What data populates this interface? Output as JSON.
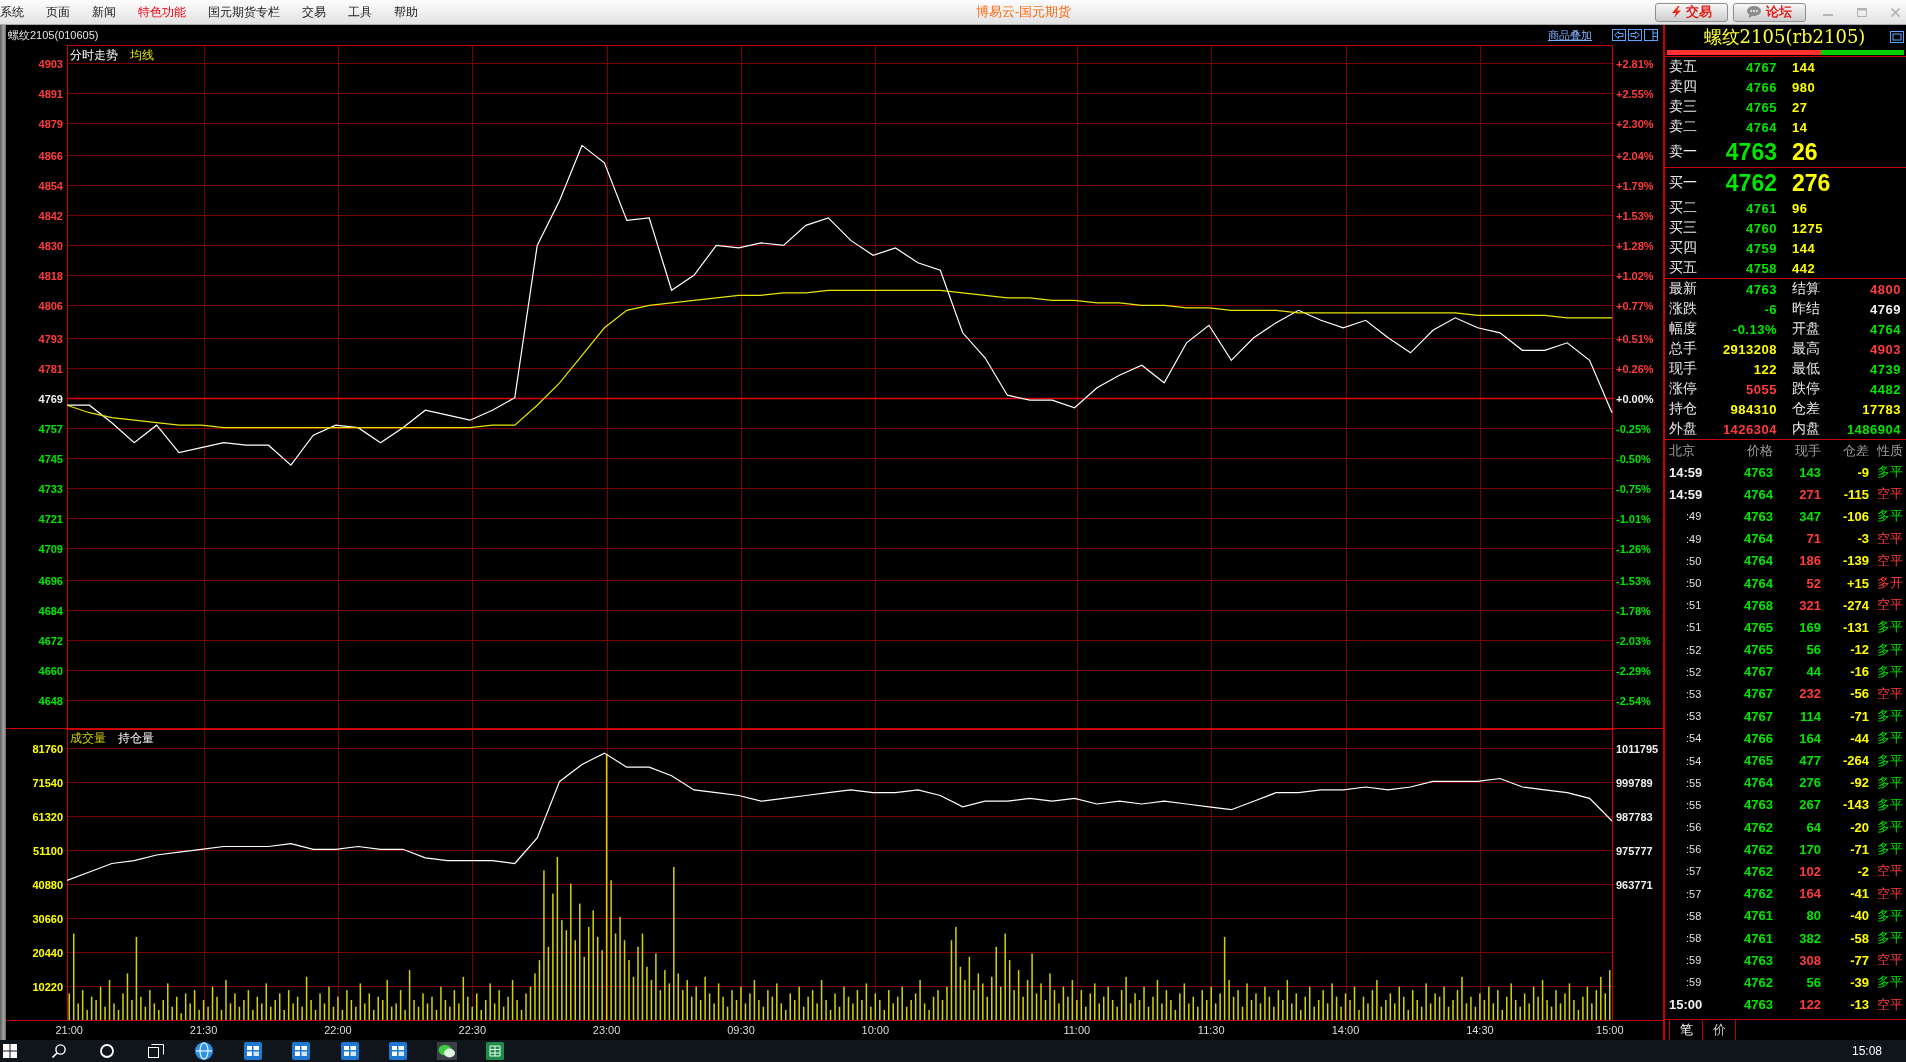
{
  "menu_bar": {
    "items": [
      {
        "label": "系统",
        "highlighted": false
      },
      {
        "label": "页面",
        "highlighted": false
      },
      {
        "label": "新闻",
        "highlighted": false
      },
      {
        "label": "特色功能",
        "highlighted": true
      },
      {
        "label": "国元期货专栏",
        "highlighted": false
      },
      {
        "label": "交易",
        "highlighted": false
      },
      {
        "label": "工具",
        "highlighted": false
      },
      {
        "label": "帮助",
        "highlighted": false
      }
    ],
    "title": "博易云-国元期货",
    "buttons": [
      {
        "kind": "trade",
        "label": "交易"
      },
      {
        "kind": "forum",
        "label": "论坛"
      }
    ]
  },
  "chart_header": {
    "symbol": "螺纹2105(010605)",
    "overlay_link": "商品叠加"
  },
  "price_panel": {
    "percent_axis": [
      "+2.81%",
      "+2.55%",
      "+2.30%",
      "+2.04%",
      "+1.79%",
      "+1.53%",
      "+1.28%",
      "+1.02%",
      "+0.77%",
      "+0.51%",
      "+0.26%",
      "+0.00%",
      "-0.25%",
      "-0.50%",
      "-0.75%",
      "-1.01%",
      "-1.26%",
      "-1.53%",
      "-1.78%",
      "-2.03%",
      "-2.29%",
      "-2.54%"
    ],
    "chart_data": {
      "type": "line",
      "ylim": [
        4636.8,
        4910.2
      ],
      "yticks": [
        4903,
        4891,
        4879,
        4866,
        4854,
        4842,
        4830,
        4818,
        4806,
        4793,
        4781,
        4769,
        4757,
        4745,
        4733,
        4721,
        4709,
        4696,
        4684,
        4672,
        4660,
        4648
      ],
      "grid": true,
      "series": [
        {
          "name": "分时走势",
          "color": "#ffffff",
          "values": [
            4766,
            4766,
            4759,
            4751,
            4758,
            4747,
            4749,
            4751,
            4750,
            4750,
            4742,
            4754,
            4758,
            4757,
            4751,
            4757,
            4764,
            4762,
            4760,
            4764,
            4769,
            4830,
            4848,
            4870,
            4863,
            4840,
            4841,
            4812,
            4818,
            4830,
            4829,
            4831,
            4830,
            4838,
            4841,
            4832,
            4826,
            4829,
            4823,
            4820,
            4795,
            4785,
            4770,
            4768,
            4768,
            4765,
            4773,
            4778,
            4782,
            4775,
            4791,
            4798,
            4784,
            4793,
            4799,
            4804,
            4800,
            4797,
            4800,
            4793,
            4787,
            4796,
            4801,
            4797,
            4795,
            4788,
            4788,
            4791,
            4784,
            4763
          ]
        },
        {
          "name": "均线",
          "color": "#e6e600",
          "values": [
            4766,
            4763,
            4761,
            4760,
            4759,
            4758,
            4758,
            4757,
            4757,
            4757,
            4757,
            4757,
            4757,
            4757,
            4757,
            4757,
            4757,
            4757,
            4757,
            4758,
            4758,
            4766,
            4775,
            4786,
            4797,
            4804,
            4806,
            4807,
            4808,
            4809,
            4810,
            4810,
            4811,
            4811,
            4812,
            4812,
            4812,
            4812,
            4812,
            4812,
            4811,
            4810,
            4809,
            4809,
            4808,
            4808,
            4807,
            4807,
            4806,
            4806,
            4805,
            4805,
            4804,
            4804,
            4804,
            4803,
            4803,
            4803,
            4803,
            4803,
            4803,
            4803,
            4803,
            4802,
            4802,
            4802,
            4802,
            4801,
            4801,
            4801
          ]
        }
      ],
      "ref_lines": [
        {
          "axis": "y",
          "value": 4769
        }
      ]
    }
  },
  "volume_panel": {
    "volume_chart": {
      "chart_data": {
        "type": "bar",
        "categories": [
          "21:00",
          null,
          null,
          null,
          null,
          null,
          null,
          null,
          null,
          null,
          null,
          null,
          null,
          null,
          null,
          null,
          null,
          null,
          null,
          null,
          null,
          null,
          null,
          null,
          null,
          null,
          null,
          null,
          null,
          null,
          "21:30",
          null,
          null,
          null,
          null,
          null,
          null,
          null,
          null,
          null,
          null,
          null,
          null,
          null,
          null,
          null,
          null,
          null,
          null,
          null,
          null,
          null,
          null,
          null,
          null,
          null,
          null,
          null,
          null,
          null,
          "22:00",
          null,
          null,
          null,
          null,
          null,
          null,
          null,
          null,
          null,
          null,
          null,
          null,
          null,
          null,
          null,
          null,
          null,
          null,
          null,
          null,
          null,
          null,
          null,
          null,
          null,
          null,
          null,
          null,
          null,
          "22:30",
          null,
          null,
          null,
          null,
          null,
          null,
          null,
          null,
          null,
          null,
          null,
          null,
          null,
          null,
          null,
          null,
          null,
          null,
          null,
          null,
          null,
          null,
          null,
          null,
          null,
          null,
          null,
          null,
          null,
          "23:00",
          null,
          null,
          null,
          null,
          null,
          null,
          null,
          null,
          null,
          null,
          null,
          null,
          null,
          null,
          null,
          null,
          null,
          null,
          null,
          null,
          null,
          null,
          null,
          null,
          null,
          null,
          null,
          null,
          null,
          "09:30",
          null,
          null,
          null,
          null,
          null,
          null,
          null,
          null,
          null,
          null,
          null,
          null,
          null,
          null,
          null,
          null,
          null,
          null,
          null,
          null,
          null,
          null,
          null,
          null,
          null,
          null,
          null,
          null,
          null,
          "10:00",
          null,
          null,
          null,
          null,
          null,
          null,
          null,
          null,
          null,
          null,
          null,
          null,
          null,
          null,
          null,
          null,
          null,
          null,
          null,
          null,
          null,
          null,
          null,
          null,
          null,
          null,
          null,
          null,
          null,
          null,
          null,
          null,
          null,
          null,
          null,
          null,
          null,
          null,
          null,
          null,
          null,
          null,
          null,
          null,
          "11:00",
          null,
          null,
          null,
          null,
          null,
          null,
          null,
          null,
          null,
          null,
          null,
          null,
          null,
          null,
          null,
          null,
          null,
          null,
          null,
          null,
          null,
          null,
          null,
          null,
          null,
          null,
          null,
          null,
          null,
          "11:30",
          null,
          null,
          null,
          null,
          null,
          null,
          null,
          null,
          null,
          null,
          null,
          null,
          null,
          null,
          null,
          null,
          null,
          null,
          null,
          null,
          null,
          null,
          null,
          null,
          null,
          null,
          null,
          null,
          null,
          "14:00",
          null,
          null,
          null,
          null,
          null,
          null,
          null,
          null,
          null,
          null,
          null,
          null,
          null,
          null,
          null,
          null,
          null,
          null,
          null,
          null,
          null,
          null,
          null,
          null,
          null,
          null,
          null,
          null,
          null,
          "14:30",
          null,
          null,
          null,
          null,
          null,
          null,
          null,
          null,
          null,
          null,
          null,
          null,
          null,
          null,
          null,
          null,
          null,
          null,
          null,
          null,
          null,
          null,
          null,
          null,
          null,
          null,
          null,
          null,
          "15:00"
        ],
        "ylim": [
          0,
          87500
        ],
        "yticks": [
          81760,
          71540,
          61320,
          51100,
          40880,
          30660,
          20440,
          10220
        ],
        "grid": true,
        "series": [
          {
            "name": "成交量",
            "color": "#d2d200",
            "values": [
              8000,
              26000,
              5000,
              9000,
              3000,
              7000,
              6000,
              10000,
              4000,
              12000,
              5000,
              3000,
              8000,
              14000,
              6000,
              25000,
              7000,
              4000,
              9000,
              5000,
              3000,
              6000,
              11000,
              4000,
              7000,
              2000,
              8000,
              5000,
              9000,
              3000,
              6000,
              4000,
              10000,
              7000,
              3000,
              12000,
              5000,
              8000,
              4000,
              6000,
              9000,
              3000,
              7000,
              5000,
              11000,
              4000,
              6000,
              8000,
              3000,
              9000,
              5000,
              7000,
              4000,
              13000,
              6000,
              3000,
              8000,
              5000,
              10000,
              4000,
              7000,
              3000,
              9000,
              6000,
              4000,
              11000,
              5000,
              8000,
              3000,
              7000,
              6000,
              12000,
              4000,
              5000,
              9000,
              3000,
              15000,
              6000,
              4000,
              8000,
              5000,
              7000,
              3000,
              10000,
              6000,
              4000,
              9000,
              5000,
              13000,
              7000,
              4000,
              8000,
              3000,
              6000,
              11000,
              5000,
              9000,
              4000,
              7000,
              12000,
              6000,
              3000,
              8000,
              10000,
              14000,
              18000,
              45000,
              22000,
              38000,
              49000,
              30000,
              27000,
              41000,
              24000,
              35000,
              19000,
              28000,
              33000,
              25000,
              21000,
              80000,
              42000,
              26000,
              31000,
              24000,
              18000,
              13000,
              22000,
              26000,
              16000,
              12000,
              20000,
              9000,
              15000,
              11000,
              46000,
              14000,
              9000,
              12000,
              7000,
              10000,
              6000,
              13000,
              8000,
              5000,
              11000,
              7000,
              4000,
              9000,
              6000,
              10000,
              5000,
              8000,
              12000,
              6000,
              4000,
              9000,
              7000,
              11000,
              5000,
              3000,
              8000,
              6000,
              10000,
              4000,
              7000,
              9000,
              5000,
              12000,
              6000,
              3000,
              8000,
              4000,
              10000,
              7000,
              5000,
              9000,
              6000,
              11000,
              4000,
              8000,
              6000,
              3000,
              9000,
              5000,
              7000,
              10000,
              4000,
              6000,
              8000,
              12000,
              5000,
              3000,
              7000,
              9000,
              6000,
              10000,
              24000,
              28000,
              16000,
              12000,
              19000,
              9000,
              14000,
              11000,
              7000,
              13000,
              22000,
              10000,
              26000,
              18000,
              9000,
              15000,
              7000,
              12000,
              20000,
              8000,
              11000,
              6000,
              14000,
              9000,
              5000,
              10000,
              7000,
              12000,
              6000,
              9000,
              4000,
              8000,
              11000,
              5000,
              7000,
              10000,
              6000,
              4000,
              9000,
              13000,
              5000,
              8000,
              6000,
              10000,
              4000,
              7000,
              12000,
              5000,
              9000,
              6000,
              3000,
              8000,
              11000,
              5000,
              7000,
              4000,
              9000,
              6000,
              10000,
              5000,
              8000,
              25000,
              12000,
              7000,
              9000,
              4000,
              11000,
              6000,
              8000,
              5000,
              10000,
              7000,
              4000,
              9000,
              6000,
              12000,
              5000,
              8000,
              3000,
              7000,
              10000,
              4000,
              6000,
              9000,
              5000,
              11000,
              7000,
              4000,
              8000,
              6000,
              10000,
              3000,
              7000,
              5000,
              9000,
              12000,
              4000,
              6000,
              8000,
              5000,
              10000,
              7000,
              3000,
              9000,
              6000,
              4000,
              11000,
              5000,
              8000,
              7000,
              10000,
              4000,
              6000,
              9000,
              13000,
              5000,
              7000,
              4000,
              8000,
              6000,
              10000,
              5000,
              9000,
              3000,
              7000,
              11000,
              6000,
              4000,
              8000,
              5000,
              10000,
              7000,
              12000,
              6000,
              4000,
              9000,
              5000,
              8000,
              11000,
              6000,
              3000,
              7000,
              10000,
              5000,
              9000,
              13000,
              8000,
              15000
            ]
          }
        ]
      }
    },
    "open_interest_chart": {
      "chart_data": {
        "type": "line",
        "ylim": [
          915700,
          1018500
        ],
        "yticks": [
          1011795,
          999789,
          987783,
          975777,
          963771
        ],
        "series": [
          {
            "name": "持仓量",
            "color": "#ffffff",
            "values": [
              965000,
              968000,
              971000,
              972000,
              974000,
              975000,
              976000,
              977000,
              977000,
              977000,
              978000,
              976000,
              976000,
              977000,
              976000,
              976000,
              973000,
              972000,
              972000,
              972000,
              971000,
              980000,
              1000000,
              1006000,
              1010000,
              1005000,
              1005000,
              1002000,
              997000,
              996000,
              995000,
              993000,
              994000,
              995000,
              996000,
              997000,
              996000,
              996000,
              997000,
              995000,
              991000,
              993000,
              993000,
              994000,
              993000,
              994000,
              992000,
              993000,
              992000,
              993000,
              992000,
              991000,
              990000,
              993000,
              996000,
              996000,
              997000,
              997000,
              998000,
              997000,
              998000,
              1000000,
              1000000,
              1000000,
              1001000,
              998000,
              997000,
              996000,
              994000,
              986000
            ]
          }
        ]
      }
    }
  },
  "quote_panel": {
    "title": "螺纹2105(rb2105)",
    "ratio_bar": {
      "level": 0.65
    },
    "asks": [
      {
        "kind": "normal",
        "label": "卖五",
        "price": "4767",
        "volume": "144"
      },
      {
        "kind": "normal",
        "label": "卖四",
        "price": "4766",
        "volume": "980"
      },
      {
        "kind": "normal",
        "label": "卖三",
        "price": "4765",
        "volume": "27"
      },
      {
        "kind": "normal",
        "label": "卖二",
        "price": "4764",
        "volume": "14"
      },
      {
        "kind": "best",
        "label": "卖一",
        "price": "4763",
        "volume": "26"
      }
    ],
    "bids": [
      {
        "kind": "best",
        "label": "买一",
        "price": "4762",
        "volume": "276"
      },
      {
        "kind": "normal",
        "label": "买二",
        "price": "4761",
        "volume": "96"
      },
      {
        "kind": "normal",
        "label": "买三",
        "price": "4760",
        "volume": "1275"
      },
      {
        "kind": "normal",
        "label": "买四",
        "price": "4759",
        "volume": "144"
      },
      {
        "kind": "normal",
        "label": "买五",
        "price": "4758",
        "volume": "442"
      }
    ],
    "stats": [
      {
        "label": "最新",
        "value": "4763",
        "color": "#00e600"
      },
      {
        "label": "结算",
        "value": "4800",
        "color": "#ff3c3c"
      },
      {
        "label": "涨跌",
        "value": "-6",
        "color": "#00e600"
      },
      {
        "label": "昨结",
        "value": "4769",
        "color": "#f0f0f0"
      },
      {
        "label": "幅度",
        "value": "-0.13%",
        "color": "#00e600"
      },
      {
        "label": "开盘",
        "value": "4764",
        "color": "#00e600"
      },
      {
        "label": "总手",
        "value": "2913208",
        "color": "#ffff00"
      },
      {
        "label": "最高",
        "value": "4903",
        "color": "#ff3c3c"
      },
      {
        "label": "现手",
        "value": "122",
        "color": "#ffff00"
      },
      {
        "label": "最低",
        "value": "4739",
        "color": "#00e600"
      },
      {
        "label": "涨停",
        "value": "5055",
        "color": "#ff3c3c"
      },
      {
        "label": "跌停",
        "value": "4482",
        "color": "#00e600"
      },
      {
        "label": "持仓",
        "value": "984310",
        "color": "#ffff00"
      },
      {
        "label": "仓差",
        "value": "17783",
        "color": "#ffff00"
      },
      {
        "label": "外盘",
        "value": "1426304",
        "color": "#ff3c3c"
      },
      {
        "label": "内盘",
        "value": "1486904",
        "color": "#00e600"
      }
    ],
    "trades": {
      "columns": [
        "北京",
        "价格",
        "现手",
        "仓差",
        "性质"
      ],
      "rows": [
        {
          "time": "14:59",
          "kind": "full",
          "price": "4763",
          "volume": "143",
          "change": "-9",
          "nature": "多平",
          "buy": false
        },
        {
          "time": "14:59",
          "kind": "full",
          "price": "4764",
          "volume": "271",
          "change": "-115",
          "nature": "空平",
          "buy": true
        },
        {
          "time": ":49",
          "kind": "seconds",
          "price": "4763",
          "volume": "347",
          "change": "-106",
          "nature": "多平",
          "buy": false
        },
        {
          "time": ":49",
          "kind": "seconds",
          "price": "4764",
          "volume": "71",
          "change": "-3",
          "nature": "空平",
          "buy": true
        },
        {
          "time": ":50",
          "kind": "seconds",
          "price": "4764",
          "volume": "186",
          "change": "-139",
          "nature": "空平",
          "buy": true
        },
        {
          "time": ":50",
          "kind": "seconds",
          "price": "4764",
          "volume": "52",
          "change": "+15",
          "nature": "多开",
          "buy": true
        },
        {
          "time": ":51",
          "kind": "seconds",
          "price": "4768",
          "volume": "321",
          "change": "-274",
          "nature": "空平",
          "buy": true
        },
        {
          "time": ":51",
          "kind": "seconds",
          "price": "4765",
          "volume": "169",
          "change": "-131",
          "nature": "多平",
          "buy": false
        },
        {
          "time": ":52",
          "kind": "seconds",
          "price": "4765",
          "volume": "56",
          "change": "-12",
          "nature": "多平",
          "buy": false
        },
        {
          "time": ":52",
          "kind": "seconds",
          "price": "4767",
          "volume": "44",
          "change": "-16",
          "nature": "多平",
          "buy": false
        },
        {
          "time": ":53",
          "kind": "seconds",
          "price": "4767",
          "volume": "232",
          "change": "-56",
          "nature": "空平",
          "buy": true
        },
        {
          "time": ":53",
          "kind": "seconds",
          "price": "4767",
          "volume": "114",
          "change": "-71",
          "nature": "多平",
          "buy": false
        },
        {
          "time": ":54",
          "kind": "seconds",
          "price": "4766",
          "volume": "164",
          "change": "-44",
          "nature": "多平",
          "buy": false
        },
        {
          "time": ":54",
          "kind": "seconds",
          "price": "4765",
          "volume": "477",
          "change": "-264",
          "nature": "多平",
          "buy": false
        },
        {
          "time": ":55",
          "kind": "seconds",
          "price": "4764",
          "volume": "276",
          "change": "-92",
          "nature": "多平",
          "buy": false
        },
        {
          "time": ":55",
          "kind": "seconds",
          "price": "4763",
          "volume": "267",
          "change": "-143",
          "nature": "多平",
          "buy": false
        },
        {
          "time": ":56",
          "kind": "seconds",
          "price": "4762",
          "volume": "64",
          "change": "-20",
          "nature": "多平",
          "buy": false
        },
        {
          "time": ":56",
          "kind": "seconds",
          "price": "4762",
          "volume": "170",
          "change": "-71",
          "nature": "多平",
          "buy": false
        },
        {
          "time": ":57",
          "kind": "seconds",
          "price": "4762",
          "volume": "102",
          "change": "-2",
          "nature": "空平",
          "buy": true
        },
        {
          "time": ":57",
          "kind": "seconds",
          "price": "4762",
          "volume": "164",
          "change": "-41",
          "nature": "空平",
          "buy": true
        },
        {
          "time": ":58",
          "kind": "seconds",
          "price": "4761",
          "volume": "80",
          "change": "-40",
          "nature": "多平",
          "buy": false
        },
        {
          "time": ":58",
          "kind": "seconds",
          "price": "4761",
          "volume": "382",
          "change": "-58",
          "nature": "多平",
          "buy": false
        },
        {
          "time": ":59",
          "kind": "seconds",
          "price": "4763",
          "volume": "308",
          "change": "-77",
          "nature": "空平",
          "buy": true
        },
        {
          "time": ":59",
          "kind": "seconds",
          "price": "4762",
          "volume": "56",
          "change": "-39",
          "nature": "多平",
          "buy": false
        },
        {
          "time": "15:00",
          "kind": "full",
          "price": "4763",
          "volume": "122",
          "change": "-13",
          "nature": "空平",
          "buy": true
        }
      ]
    },
    "tabs": [
      {
        "label": "笔",
        "selected": true
      },
      {
        "label": "价",
        "selected": false
      }
    ]
  },
  "taskbar": {
    "clock": "15:08"
  }
}
